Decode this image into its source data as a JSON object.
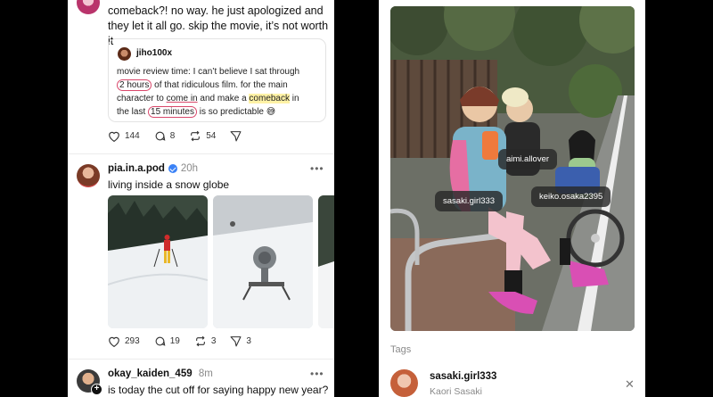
{
  "post1": {
    "text": "comeback?! no way. he just apologized and they let it all go. skip the movie, it’s not worth it",
    "quote": {
      "username": "jiho100x",
      "line1": "movie review time: I can’t believe I sat through",
      "line2a": "2 hours",
      "line2b": " of that ridiculous film. for the main",
      "line3a": "character to ",
      "line3b": "come in",
      "line3c": " and make a ",
      "line3d": "comeback",
      "line3e": " in",
      "line4a": "the last ",
      "line4b": "15 minutes",
      "line4c": " is so predictable 😅"
    },
    "likes": "144",
    "replies": "8",
    "reposts": "54"
  },
  "post2": {
    "username": "pia.in.a.pod",
    "time": "20h",
    "text": "living inside a snow globe",
    "likes": "293",
    "replies": "19",
    "reposts": "3",
    "shares": "3"
  },
  "post3": {
    "username": "okay_kaiden_459",
    "time": "8m",
    "text": "is today the cut off for saying happy new year?"
  },
  "photo_tags": [
    {
      "label": "aimi.allover"
    },
    {
      "label": "sasaki.girl333"
    },
    {
      "label": "keiko.osaka2395"
    }
  ],
  "tags_section": {
    "title": "Tags",
    "username": "sasaki.girl333",
    "display_name": "Kaori Sasaki"
  },
  "icons": {
    "more": "more-horizontal-icon",
    "like": "heart-icon",
    "reply": "comment-icon",
    "repost": "repost-icon",
    "share": "send-icon",
    "close": "close-icon"
  },
  "colors": {
    "verified": "#3b82f6",
    "highlight": "#fff2a6",
    "circle_mark": "#d9486b"
  }
}
